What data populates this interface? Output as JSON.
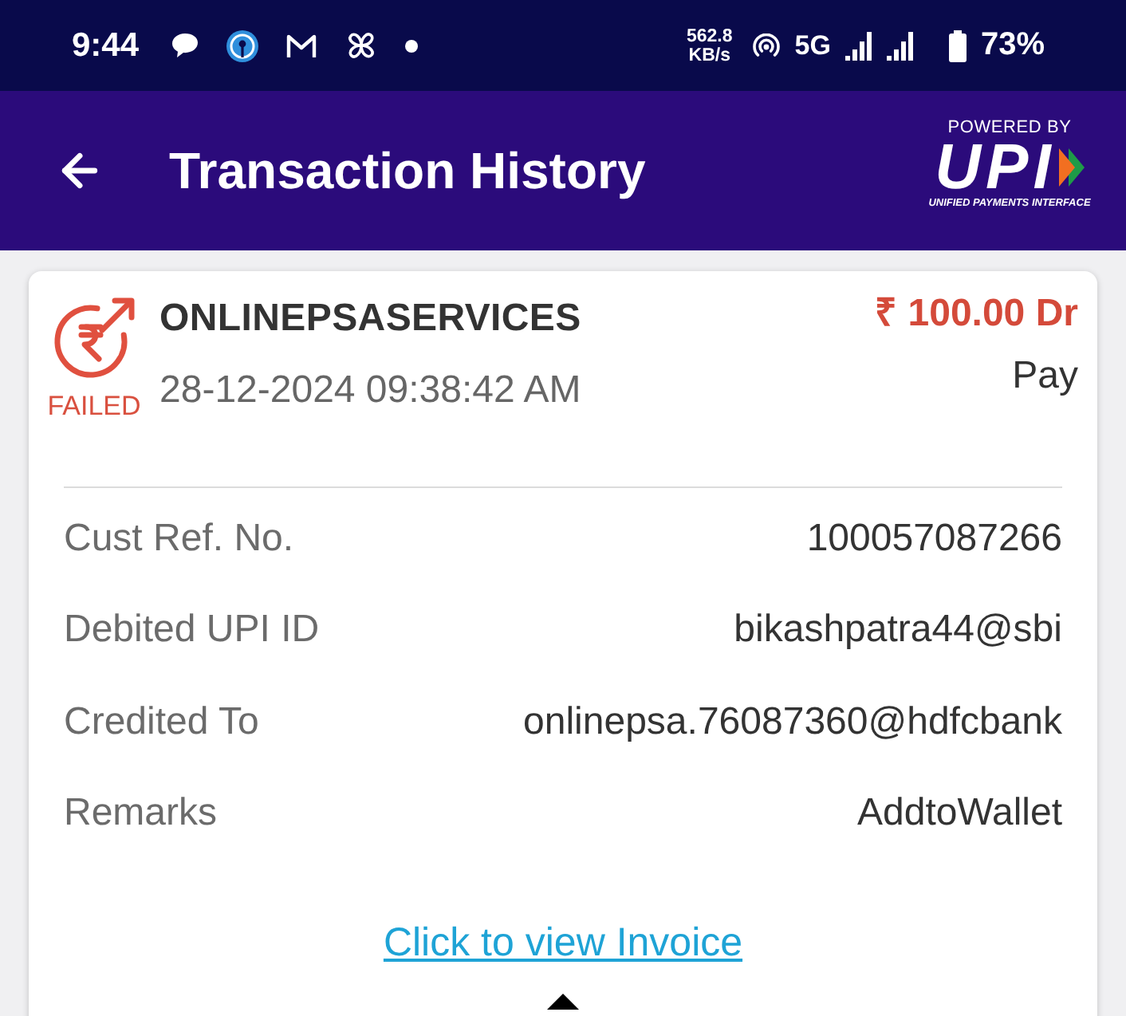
{
  "status_bar": {
    "time": "9:44",
    "speed": "562.8",
    "speed_unit": "KB/s",
    "network": "5G",
    "battery": "73%"
  },
  "header": {
    "title": "Transaction History",
    "logo": {
      "tagline_top": "POWERED BY",
      "wordmark": "UPI",
      "tagline_bottom": "UNIFIED PAYMENTS INTERFACE"
    }
  },
  "transaction": {
    "status": "FAILED",
    "payee": "ONLINEPSASERVICES",
    "datetime": "28-12-2024 09:38:42 AM",
    "amount": "₹ 100.00 Dr",
    "type": "Pay",
    "details": [
      {
        "label": "Cust Ref. No.",
        "value": "100057087266"
      },
      {
        "label": "Debited UPI ID",
        "value": "bikashpatra44@sbi"
      },
      {
        "label": "Credited To",
        "value": "onlinepsa.76087360@hdfcbank"
      },
      {
        "label": "Remarks",
        "value": "AddtoWallet"
      }
    ],
    "invoice_link": "Click to view Invoice",
    "expanded": true
  }
}
